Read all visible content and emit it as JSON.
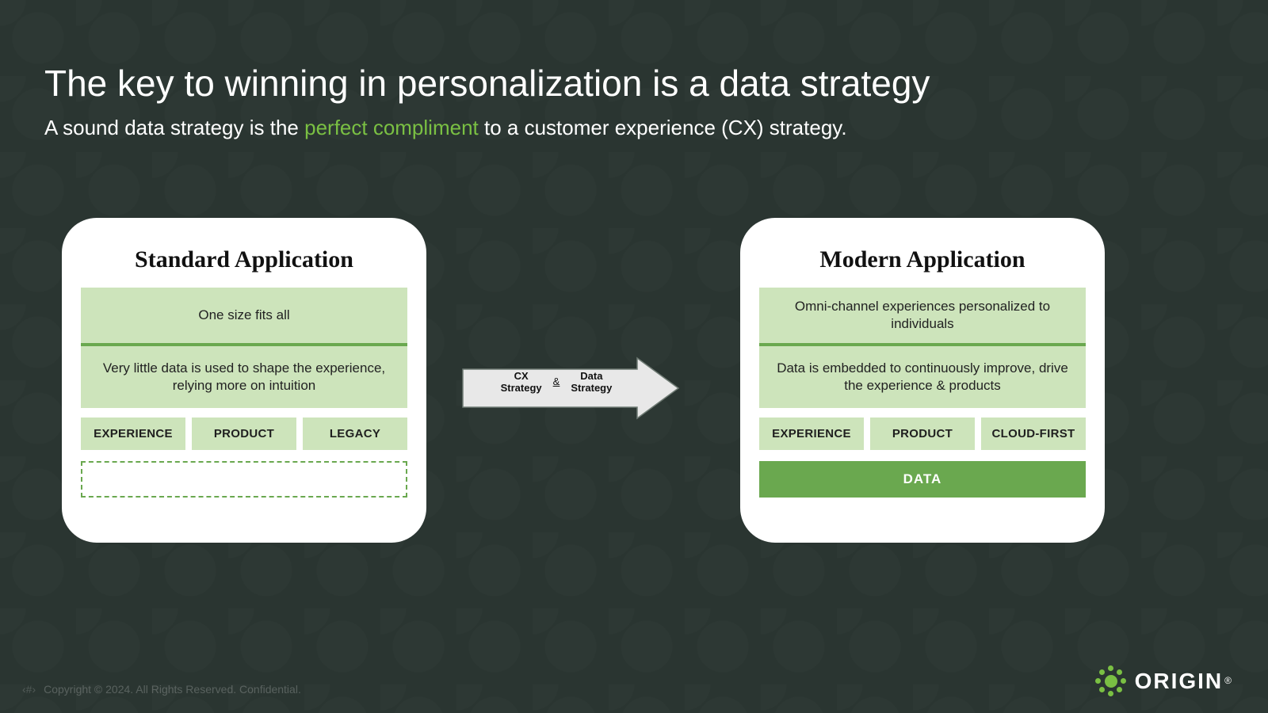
{
  "header": {
    "title": "The key to winning in personalization is a data strategy",
    "subtitle_before": "A sound data strategy is the ",
    "subtitle_highlight": "perfect compliment",
    "subtitle_after": " to a customer experience (CX) strategy."
  },
  "left_card": {
    "title": "Standard Application",
    "top": "One size fits all",
    "mid": "Very little data is used to shape the experience, relying more on intuition",
    "tags": [
      "EXPERIENCE",
      "PRODUCT",
      "LEGACY"
    ]
  },
  "right_card": {
    "title": "Modern Application",
    "top": "Omni-channel experiences personalized to individuals",
    "mid": "Data is embedded to continuously improve, drive the experience & products",
    "tags": [
      "EXPERIENCE",
      "PRODUCT",
      "CLOUD-FIRST"
    ],
    "data_label": "DATA"
  },
  "arrow": {
    "left_line1": "CX",
    "left_line2": "Strategy",
    "amp": "&",
    "right_line1": "Data",
    "right_line2": "Strategy"
  },
  "footer": {
    "page_marker": "‹#›",
    "copyright": "Copyright © 2024.  All Rights Reserved.  Confidential."
  },
  "brand": {
    "name": "ORIGIN",
    "reg": "®",
    "accent_color": "#7ac043"
  }
}
